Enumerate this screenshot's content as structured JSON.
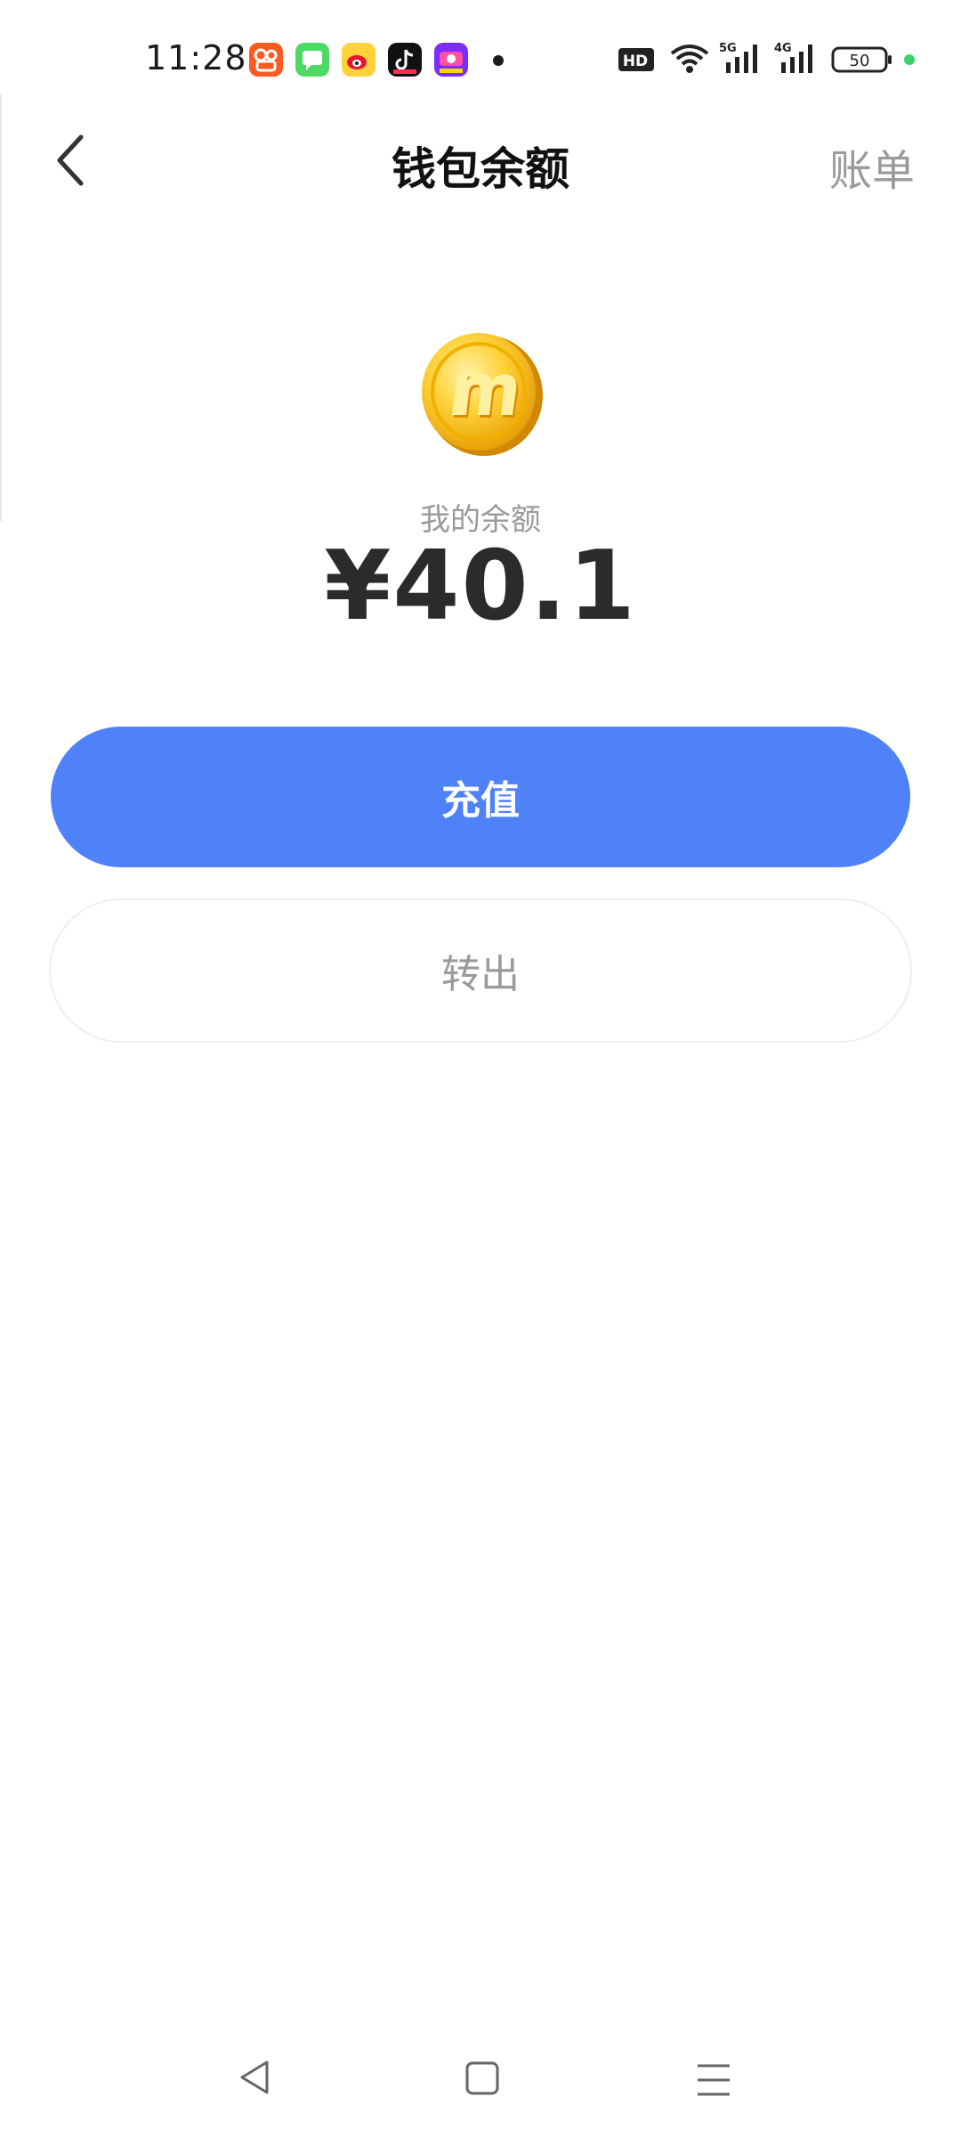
{
  "status_bar": {
    "time": "11:28",
    "apps": [
      "kuaishou-icon",
      "messages-icon",
      "weibo-icon",
      "douyin-icon",
      "video-app-icon"
    ],
    "hd_label": "HD",
    "net1": "5G",
    "net2": "4G",
    "battery": "50",
    "colors": {
      "charging_dot": "#3ccf6b"
    }
  },
  "header": {
    "title": "钱包余额",
    "bill_label": "账单"
  },
  "balance": {
    "label": "我的余额",
    "amount": "¥40.1"
  },
  "actions": {
    "recharge_label": "充值",
    "transfer_label": "转出"
  },
  "colors": {
    "primary": "#4f82f9",
    "muted_text": "#9a9a9a",
    "coin": "#f5c518"
  }
}
